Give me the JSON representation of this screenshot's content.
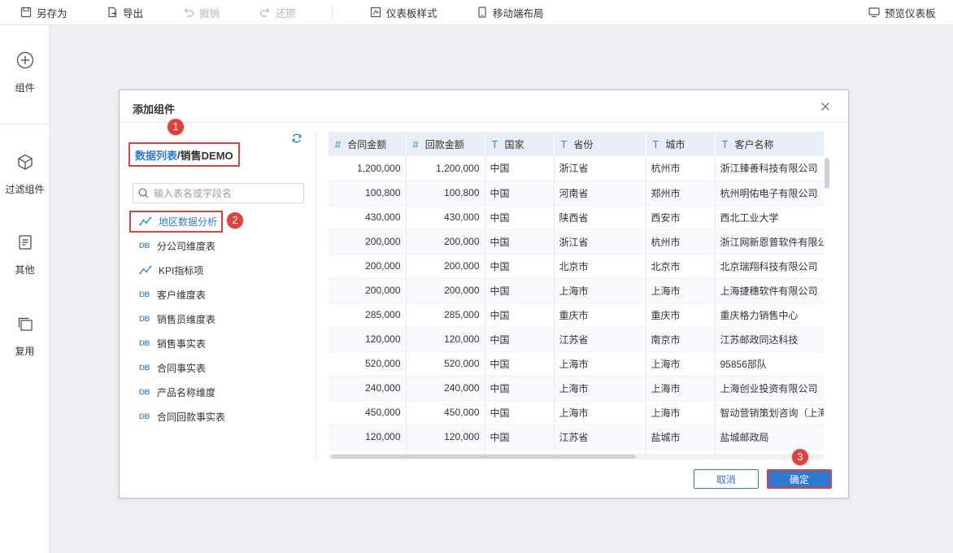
{
  "toolbar": {
    "save_as": "另存为",
    "export": "导出",
    "undo": "撤销",
    "redo": "还原",
    "dashboard_style": "仪表板样式",
    "mobile_layout": "移动端布局",
    "preview": "预览仪表板"
  },
  "sidebar": {
    "items": [
      {
        "label": "组件",
        "icon": "plus-circle-icon"
      },
      {
        "label": "过滤组件",
        "icon": "cube-icon"
      },
      {
        "label": "其他",
        "icon": "document-icon"
      },
      {
        "label": "复用",
        "icon": "stack-icon"
      }
    ]
  },
  "dialog": {
    "title": "添加组件",
    "datasource": {
      "link": "数据列表",
      "separator": "/",
      "name": "销售DEMO"
    },
    "search_placeholder": "输入表名或字段名",
    "tables": [
      {
        "label": "地区数据分析",
        "type": "analysis",
        "selected": true
      },
      {
        "label": "分公司维度表",
        "type": "DB"
      },
      {
        "label": "KPI指标项",
        "type": "analysis"
      },
      {
        "label": "客户维度表",
        "type": "DB"
      },
      {
        "label": "销售员维度表",
        "type": "DB"
      },
      {
        "label": "销售事实表",
        "type": "DB"
      },
      {
        "label": "合同事实表",
        "type": "DB"
      },
      {
        "label": "产品名称维度",
        "type": "DB"
      },
      {
        "label": "合同回款事实表",
        "type": "DB"
      }
    ],
    "columns": [
      {
        "type": "#",
        "name": "合同金额"
      },
      {
        "type": "#",
        "name": "回款金额"
      },
      {
        "type": "T",
        "name": "国家"
      },
      {
        "type": "T",
        "name": "省份"
      },
      {
        "type": "T",
        "name": "城市"
      },
      {
        "type": "T",
        "name": "客户名称"
      }
    ],
    "rows": [
      [
        "1,200,000",
        "1,200,000",
        "中国",
        "浙江省",
        "杭州市",
        "浙江臻善科技有限公司"
      ],
      [
        "100,800",
        "100,800",
        "中国",
        "河南省",
        "郑州市",
        "杭州明佑电子有限公司"
      ],
      [
        "430,000",
        "430,000",
        "中国",
        "陕西省",
        "西安市",
        "西北工业大学"
      ],
      [
        "200,000",
        "200,000",
        "中国",
        "浙江省",
        "杭州市",
        "浙江网新恩普软件有限公司"
      ],
      [
        "200,000",
        "200,000",
        "中国",
        "北京市",
        "北京市",
        "北京瑞翔科技有限公司"
      ],
      [
        "200,000",
        "200,000",
        "中国",
        "上海市",
        "上海市",
        "上海捷穗软件有限公司"
      ],
      [
        "285,000",
        "285,000",
        "中国",
        "重庆市",
        "重庆市",
        "重庆格力销售中心"
      ],
      [
        "120,000",
        "120,000",
        "中国",
        "江苏省",
        "南京市",
        "江苏邮政同达科技"
      ],
      [
        "520,000",
        "520,000",
        "中国",
        "上海市",
        "上海市",
        "95856部队"
      ],
      [
        "240,000",
        "240,000",
        "中国",
        "上海市",
        "上海市",
        "上海创业投资有限公司"
      ],
      [
        "450,000",
        "450,000",
        "中国",
        "上海市",
        "上海市",
        "智动营销策划咨询（上海）"
      ],
      [
        "120,000",
        "120,000",
        "中国",
        "江苏省",
        "盐城市",
        "盐城邮政局"
      ],
      [
        "",
        "",
        "",
        "",
        "",
        ""
      ]
    ],
    "cancel": "取消",
    "confirm": "确定"
  },
  "markers": [
    "1",
    "2",
    "3"
  ],
  "colors": {
    "accent": "#2f7ad1",
    "highlight": "#e0403e"
  }
}
